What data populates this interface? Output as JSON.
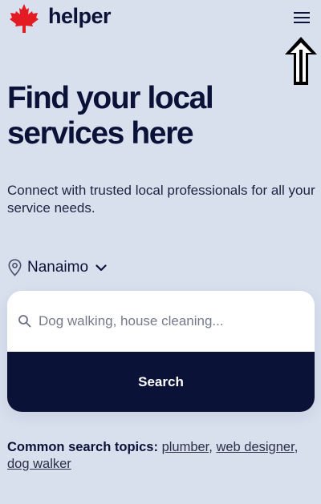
{
  "header": {
    "brand": "helper",
    "menu_icon": "hamburger-menu-icon",
    "logo_icon": "maple-leaf-icon"
  },
  "annotation": {
    "arrow_icon": "up-arrow-icon"
  },
  "hero": {
    "title_line1": "Find your local",
    "title_line2": "services here",
    "subtitle": "Connect with trusted local professionals for all your service needs."
  },
  "location": {
    "icon": "map-pin-icon",
    "value": "Nanaimo",
    "dropdown_icon": "chevron-down-icon"
  },
  "search": {
    "placeholder": "Dog walking, house cleaning...",
    "value": "",
    "button_label": "Search"
  },
  "topics": {
    "label": "Common search topics:",
    "items": [
      "plumber",
      "web designer",
      "dog walker"
    ]
  },
  "colors": {
    "background": "#d8e0ee",
    "navy": "#0b1238",
    "leaf_red": "#e31b23",
    "card": "#ffffff"
  }
}
